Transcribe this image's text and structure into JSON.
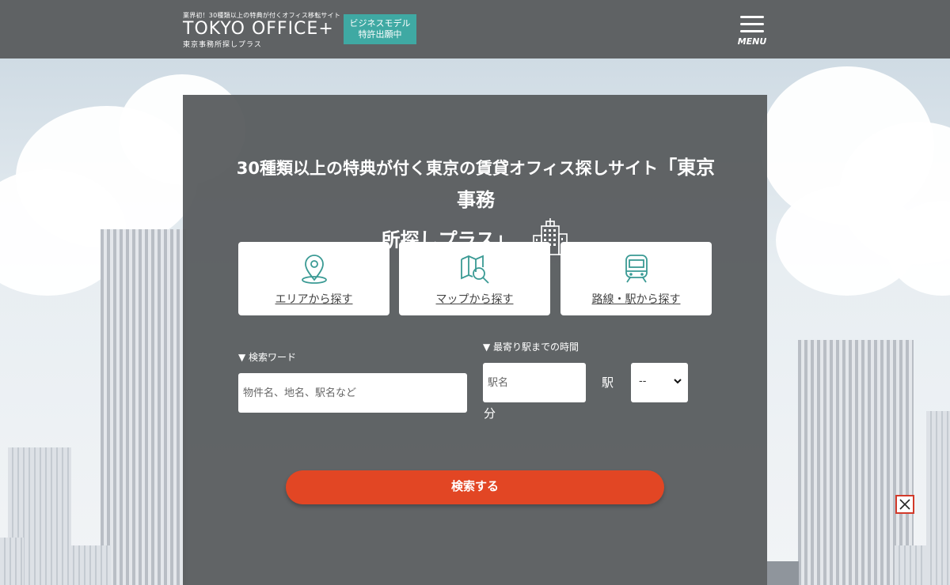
{
  "header": {
    "tagline": "業界初！30種類以上の特典が付くオフィス移転サイト",
    "logo_main": "TOKYO OFFICE+",
    "logo_sub": "東京事務所探しプラス",
    "badge_line1": "ビジネスモデル",
    "badge_line2": "特許出願中",
    "menu_label": "MENU"
  },
  "hero": {
    "headline_part1": "30種類以上の特典が付く東京の賃貸オフィス探しサイト",
    "headline_part2": "「東京事務",
    "headline_part3": "所探しプラス」"
  },
  "search_modes": [
    {
      "label": "エリアから探す",
      "icon": "map-pin-icon"
    },
    {
      "label": "マップから探す",
      "icon": "map-search-icon"
    },
    {
      "label": "路線・駅から探す",
      "icon": "train-icon"
    }
  ],
  "form": {
    "keyword_label": "▼ 検索ワード",
    "keyword_placeholder": "物件名、地名、駅名など",
    "station_label": "▼ 最寄り駅までの時間",
    "station_placeholder": "駅名",
    "station_suffix": "駅",
    "minutes_value": "--",
    "minutes_suffix": "分",
    "submit_label": "検索する"
  },
  "colors": {
    "header_bg": "#5f6264",
    "badge_bg": "#3fa9a3",
    "accent": "#e24624",
    "icon_teal": "#3a9a94"
  }
}
